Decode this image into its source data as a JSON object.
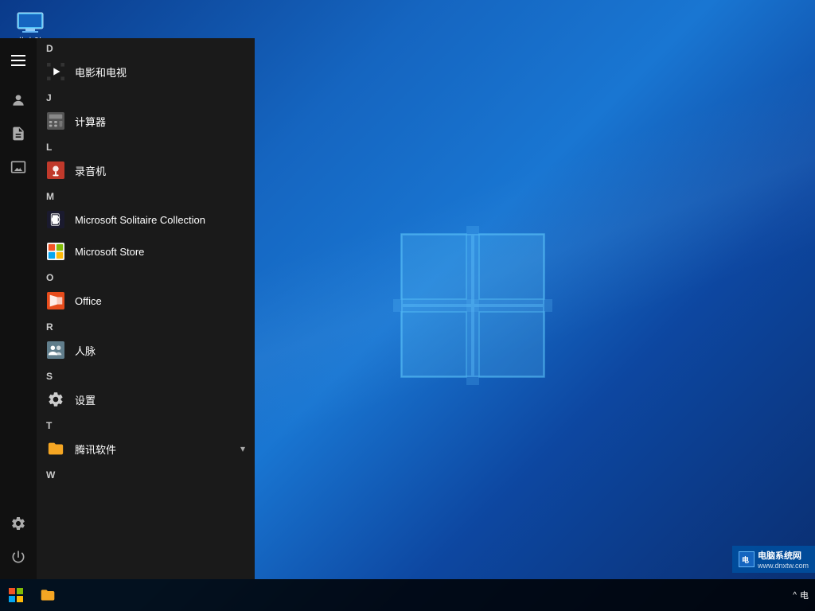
{
  "desktop": {
    "icon_label": "此电脑",
    "background_desc": "Windows 10 blue gradient"
  },
  "start_menu": {
    "hamburger_label": "Menu",
    "sections": [
      {
        "letter": "D",
        "items": [
          {
            "id": "movies",
            "name": "电影和电视",
            "icon_type": "film"
          }
        ]
      },
      {
        "letter": "J",
        "items": [
          {
            "id": "calculator",
            "name": "计算器",
            "icon_type": "calc"
          }
        ]
      },
      {
        "letter": "L",
        "items": [
          {
            "id": "recorder",
            "name": "录音机",
            "icon_type": "mic"
          }
        ]
      },
      {
        "letter": "M",
        "items": [
          {
            "id": "solitaire",
            "name": "Microsoft Solitaire Collection",
            "icon_type": "cards"
          },
          {
            "id": "store",
            "name": "Microsoft Store",
            "icon_type": "store"
          }
        ]
      },
      {
        "letter": "O",
        "items": [
          {
            "id": "office",
            "name": "Office",
            "icon_type": "office"
          }
        ]
      },
      {
        "letter": "R",
        "items": [
          {
            "id": "contacts",
            "name": "人脉",
            "icon_type": "people"
          }
        ]
      },
      {
        "letter": "S",
        "items": [
          {
            "id": "settings",
            "name": "设置",
            "icon_type": "gear"
          }
        ]
      },
      {
        "letter": "T",
        "items": [
          {
            "id": "tencent",
            "name": "腾讯软件",
            "icon_type": "folder",
            "has_arrow": true
          }
        ]
      },
      {
        "letter": "W",
        "items": []
      }
    ]
  },
  "sidebar_icons": [
    {
      "id": "hamburger",
      "label": "Menu"
    },
    {
      "id": "user",
      "label": "User"
    },
    {
      "id": "file",
      "label": "Documents"
    },
    {
      "id": "photo",
      "label": "Pictures"
    },
    {
      "id": "settings",
      "label": "Settings"
    },
    {
      "id": "power",
      "label": "Power"
    }
  ],
  "taskbar": {
    "start_label": "Start",
    "file_explorer_label": "File Explorer",
    "notification_chevron": "^",
    "system_tray_text": "电"
  },
  "watermark": {
    "site": "电脑系统网",
    "url": "www.dnxtw.com"
  }
}
